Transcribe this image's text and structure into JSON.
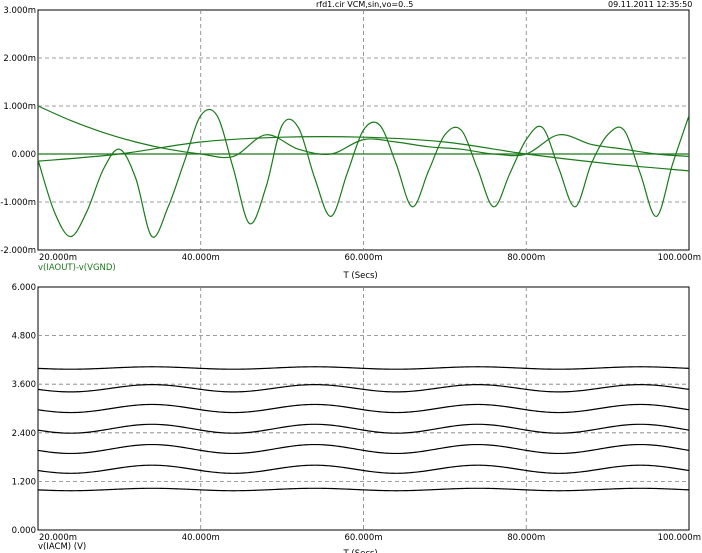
{
  "header": {
    "file": "rfd1.cir VCM,sin,vo=0..5",
    "datetime": "09.11.2011 12:35:50"
  },
  "colors": {
    "top_trace": "#1a7a1a",
    "bottom_trace": "#000000",
    "grid": "#7f7f7f",
    "legend_top": "#1a7a1a",
    "legend_bottom": "#000000"
  },
  "chart_data": [
    {
      "type": "line",
      "title": "",
      "xlabel": "T (Secs)",
      "ylabel": "",
      "legend": "v(IAOUT)-v(VGND)",
      "xlim": [
        0.02,
        0.1
      ],
      "ylim": [
        -0.002,
        0.003
      ],
      "grid": true,
      "x_ticks": [
        "20.000m",
        "40.000m",
        "60.000m",
        "80.000m",
        "100.000m"
      ],
      "y_ticks": [
        "3.000m",
        "2.000m",
        "1.000m",
        "0.000",
        "-1.000m",
        "-2.000m"
      ],
      "series": [
        {
          "x": [
            0.02,
            0.022,
            0.024,
            0.026,
            0.028,
            0.03,
            0.032,
            0.034,
            0.036,
            0.038,
            0.04,
            0.042,
            0.044,
            0.046,
            0.048,
            0.05,
            0.052,
            0.054,
            0.056,
            0.058,
            0.06,
            0.062,
            0.064,
            0.066,
            0.068,
            0.07,
            0.072,
            0.074,
            0.076,
            0.078,
            0.08,
            0.082,
            0.084,
            0.086,
            0.088,
            0.09,
            0.092,
            0.094,
            0.096,
            0.098,
            0.1
          ],
          "values": [
            -0.00012,
            -0.0012,
            -0.00172,
            -0.0012,
            -0.00033,
            0.0001,
            -0.0005,
            -0.00172,
            -0.0011,
            -0.00015,
            0.0008,
            0.0008,
            -0.0003,
            -0.00145,
            -0.0007,
            0.0006,
            0.00055,
            -0.0005,
            -0.0013,
            -0.0004,
            0.0005,
            0.0006,
            -0.0002,
            -0.0011,
            -0.00035,
            0.0004,
            0.0005,
            -0.0003,
            -0.0011,
            -0.0004,
            0.0003,
            0.00055,
            -0.0003,
            -0.0011,
            -0.0002,
            0.0004,
            0.0005,
            -0.0004,
            -0.0013,
            -0.0002,
            0.0008
          ]
        },
        {
          "x": [
            0.02,
            0.024,
            0.028,
            0.032,
            0.036,
            0.04,
            0.044,
            0.048,
            0.052,
            0.056,
            0.06,
            0.064,
            0.068,
            0.072,
            0.076,
            0.08,
            0.084,
            0.088,
            0.092,
            0.096,
            0.1
          ],
          "values": [
            0.001,
            0.0007,
            0.00045,
            0.00025,
            0.0001,
            0.0,
            -5e-05,
            0.0004,
            0.0001,
            0.0,
            0.0003,
            0.00025,
            0.00015,
            0.0001,
            0.0,
            0.0,
            0.0004,
            0.0002,
            0.0001,
            0.0,
            -5e-05
          ]
        },
        {
          "x": [
            0.02,
            0.03,
            0.04,
            0.05,
            0.06,
            0.07,
            0.08,
            0.09,
            0.1
          ],
          "values": [
            -0.00015,
            0.0,
            0.00025,
            0.00035,
            0.00035,
            0.00025,
            0.0,
            -0.0002,
            -0.00035
          ]
        },
        {
          "x": [
            0.02,
            0.1
          ],
          "values": [
            0.0,
            0.0
          ]
        }
      ]
    },
    {
      "type": "line",
      "title": "",
      "xlabel": "T (Secs)",
      "ylabel": "",
      "legend": "v(IACM) (V)",
      "xlim": [
        0.02,
        0.1
      ],
      "ylim": [
        0,
        6
      ],
      "grid": true,
      "x_ticks": [
        "20.000m",
        "40.000m",
        "60.000m",
        "80.000m",
        "100.000m"
      ],
      "y_ticks": [
        "6.000",
        "4.800",
        "3.600",
        "2.400",
        "1.200",
        "0.000"
      ],
      "series_common": {
        "period": 0.02,
        "phase_x": 0.024
      },
      "series": [
        {
          "offset": 4.0,
          "amplitude": 0.03
        },
        {
          "offset": 3.5,
          "amplitude": 0.09
        },
        {
          "offset": 3.0,
          "amplitude": 0.1
        },
        {
          "offset": 2.5,
          "amplitude": 0.11
        },
        {
          "offset": 2.0,
          "amplitude": 0.11
        },
        {
          "offset": 1.5,
          "amplitude": 0.1
        },
        {
          "offset": 1.0,
          "amplitude": 0.03
        }
      ]
    }
  ]
}
